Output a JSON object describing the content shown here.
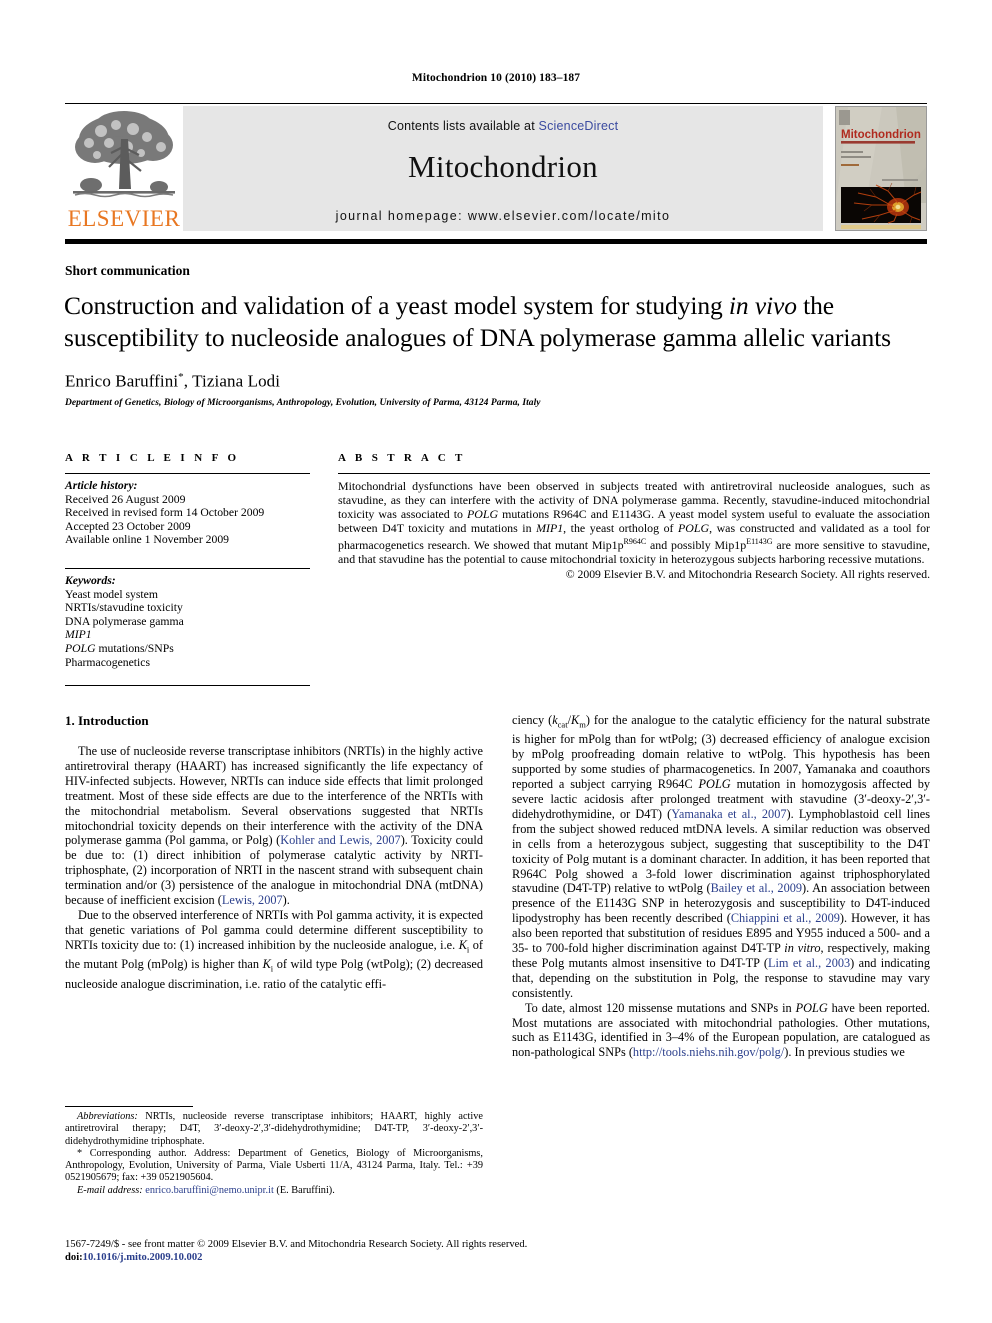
{
  "running_head": "Mitochondrion 10 (2010) 183–187",
  "masthead": {
    "publisher_wordmark": "ELSEVIER",
    "contents_prefix": "Contents lists available at ",
    "contents_link": "ScienceDirect",
    "journal_title": "Mitochondrion",
    "homepage": "journal homepage: www.elsevier.com/locate/mito",
    "cover_title": "Mitochondrion",
    "colors": {
      "elsevier_orange": "#e87722",
      "link_blue": "#3b4ba0",
      "masthead_grey": "#e6e6e6",
      "reference_blue": "#2b3f8c"
    }
  },
  "article": {
    "type": "Short communication",
    "title_line1_a": "Construction and validation of a yeast model system for studying ",
    "title_line1_i": "in vivo",
    "title_line1_b": " the",
    "title_line2": "susceptibility to nucleoside analogues of DNA polymerase gamma allelic variants",
    "authors": "Enrico Baruffini",
    "corresponding_mark": "*",
    "authors_rest": ", Tiziana Lodi",
    "affiliation": "Department of Genetics, Biology of Microorganisms, Anthropology, Evolution, University of Parma, 43124 Parma, Italy"
  },
  "article_info": {
    "heading": "A R T I C L E  I N F O",
    "history_label": "Article history:",
    "history": [
      "Received 26 August 2009",
      "Received in revised form 14 October 2009",
      "Accepted 23 October 2009",
      "Available online 1 November 2009"
    ],
    "keywords_label": "Keywords:",
    "keywords": [
      "Yeast model system",
      "NRTIs/stavudine toxicity",
      "DNA polymerase gamma",
      "MIP1",
      "POLG mutations/SNPs",
      "Pharmacogenetics"
    ]
  },
  "abstract": {
    "heading": "A B S T R A C T",
    "copyright": "© 2009 Elsevier B.V. and Mitochondria Research Society. All rights reserved."
  },
  "body": {
    "section1_title": "1. Introduction",
    "footnotes": {
      "abbrev_label": "Abbreviations:",
      "abbrev_text": " NRTIs, nucleoside reverse transcriptase inhibitors; HAART, highly active antiretroviral therapy; D4T, 3′-deoxy-2′,3′-didehydrothymidine; D4T-TP, 3′-deoxy-2′,3′-didehydrothymidine triphosphate.",
      "corresponding": "* Corresponding author. Address: Department of Genetics, Biology of Microorganisms, Anthropology, Evolution, University of Parma, Viale Usberti 11/A, 43124 Parma, Italy. Tel.: +39 0521905679; fax: +39 0521905604.",
      "email_label": "E-mail address:",
      "email": "enrico.baruffini@nemo.unipr.it",
      "email_suffix": " (E. Baruffini)."
    }
  },
  "footer": {
    "issn": "1567-7249/$ - see front matter © 2009 Elsevier B.V. and Mitochondria Research Society. All rights reserved.",
    "doi_label": "doi:",
    "doi_value": "10.1016/j.mito.2009.10.002"
  }
}
